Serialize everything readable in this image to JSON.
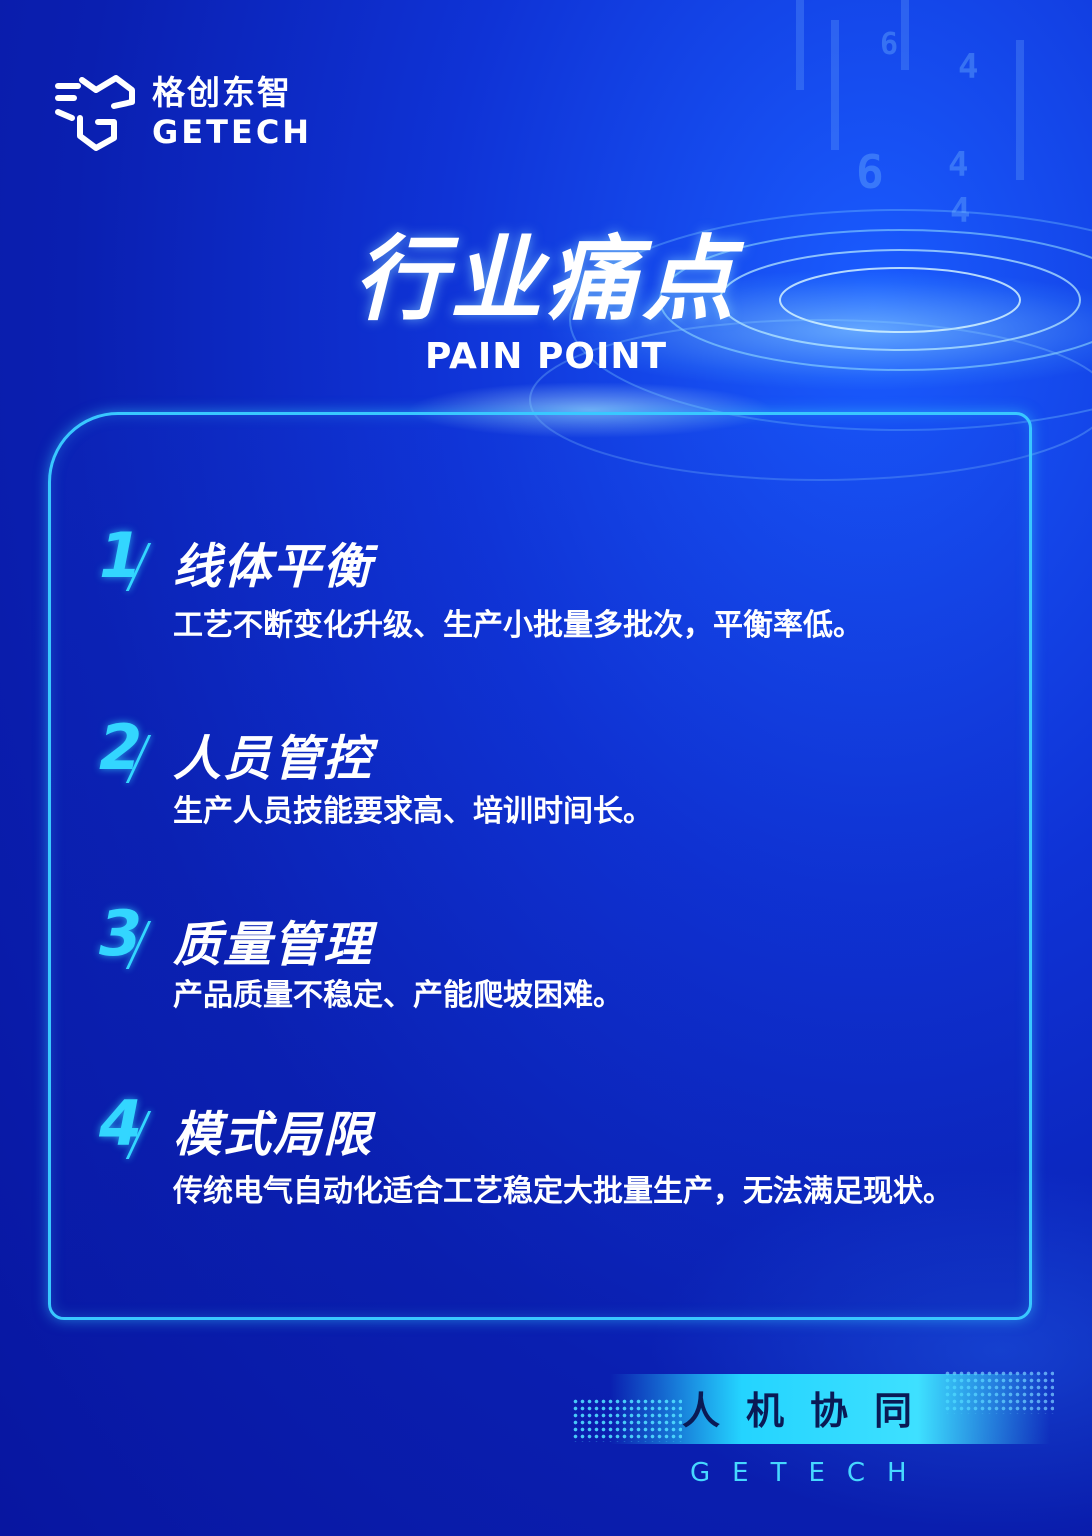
{
  "brand": {
    "name_cn": "格创东智",
    "name_en": "GETECH"
  },
  "header": {
    "title": "行业痛点",
    "subtitle": "PAIN POINT"
  },
  "items": [
    {
      "number": "1",
      "title": "线体平衡",
      "description": "工艺不断变化升级、生产小批量多批次，平衡率低。"
    },
    {
      "number": "2",
      "title": "人员管控",
      "description": "生产人员技能要求高、培训时间长。"
    },
    {
      "number": "3",
      "title": "质量管理",
      "description": "产品质量不稳定、产能爬坡困难。"
    },
    {
      "number": "4",
      "title": "模式局限",
      "description": "传统电气自动化适合工艺稳定大批量生产，无法满足现状。"
    }
  ],
  "footer": {
    "slogan": "人机协同",
    "brand_en": "GETECH"
  },
  "colors": {
    "accent": "#33d6ff",
    "background": "#0f33d6",
    "panel_border": "#39c8ff"
  },
  "icons": [
    "getech-logo-icon"
  ]
}
